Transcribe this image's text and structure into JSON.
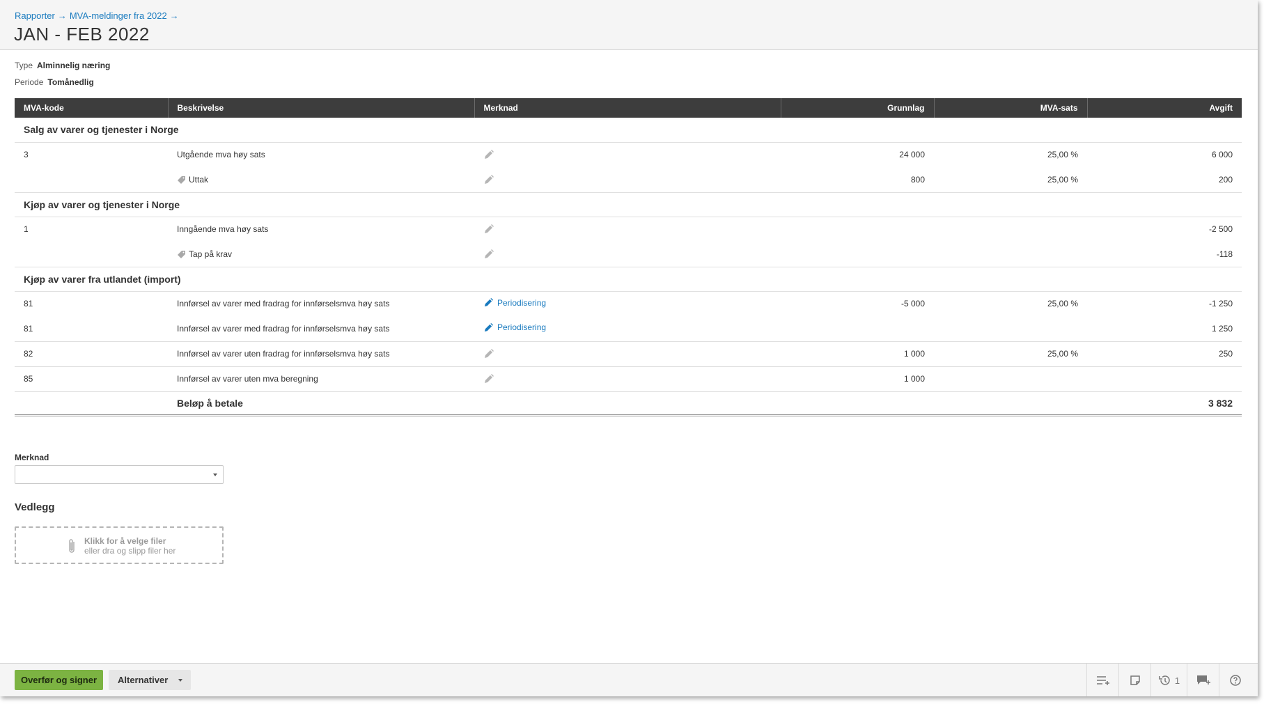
{
  "breadcrumb": {
    "item1": "Rapporter",
    "item2": "MVA-meldinger fra 2022",
    "arrow": "→"
  },
  "title": "JAN - FEB 2022",
  "meta": {
    "type_label": "Type",
    "type_value": "Alminnelig næring",
    "period_label": "Periode",
    "period_value": "Tomånedlig"
  },
  "table": {
    "headers": {
      "code": "MVA-kode",
      "desc": "Beskrivelse",
      "note": "Merknad",
      "base": "Grunnlag",
      "rate": "MVA-sats",
      "fee": "Avgift"
    },
    "groups": [
      {
        "title": "Salg av varer og tjenester i Norge"
      },
      {
        "title": "Kjøp av varer og tjenester i Norge"
      },
      {
        "title": "Kjøp av varer fra utlandet (import)"
      }
    ],
    "rows": [
      {
        "code": "3",
        "desc": "Utgående mva høy sats",
        "base": "24 000",
        "rate": "25,00 %",
        "fee": "6 000"
      },
      {
        "code": "",
        "desc": "Uttak",
        "base": "800",
        "rate": "25,00 %",
        "fee": "200"
      },
      {
        "code": "1",
        "desc": "Inngående mva høy sats",
        "base": "",
        "rate": "",
        "fee": "-2 500"
      },
      {
        "code": "",
        "desc": "Tap på krav",
        "base": "",
        "rate": "",
        "fee": "-118"
      },
      {
        "code": "81",
        "desc": "Innførsel av varer med fradrag for innførselsmva høy sats",
        "note": "Periodisering",
        "base": "-5 000",
        "rate": "25,00 %",
        "fee": "-1 250"
      },
      {
        "code": "81",
        "desc": "Innførsel av varer med fradrag for innførselsmva høy sats",
        "note": "Periodisering",
        "base": "",
        "rate": "",
        "fee": "1 250"
      },
      {
        "code": "82",
        "desc": "Innførsel av varer uten fradrag for innførselsmva høy sats",
        "base": "1 000",
        "rate": "25,00 %",
        "fee": "250"
      },
      {
        "code": "85",
        "desc": "Innførsel av varer uten mva beregning",
        "base": "1 000",
        "rate": "",
        "fee": ""
      }
    ],
    "total": {
      "label": "Beløp å betale",
      "value": "3 832"
    }
  },
  "form": {
    "note_label": "Merknad",
    "note_value": "",
    "attachments_title": "Vedlegg",
    "dropzone_line1": "Klikk for å velge filer",
    "dropzone_line2": "eller dra og slipp filer her"
  },
  "footer": {
    "primary_button": "Overfør og signer",
    "alternatives_button": "Alternativer",
    "history_count": "1",
    "icons": [
      "task-list-icon",
      "note-icon",
      "history-icon",
      "comment-add-icon",
      "help-icon"
    ]
  },
  "colors": {
    "link": "#1a7bbf",
    "primary": "#7cb342",
    "header_bg": "#3d3d3d"
  }
}
